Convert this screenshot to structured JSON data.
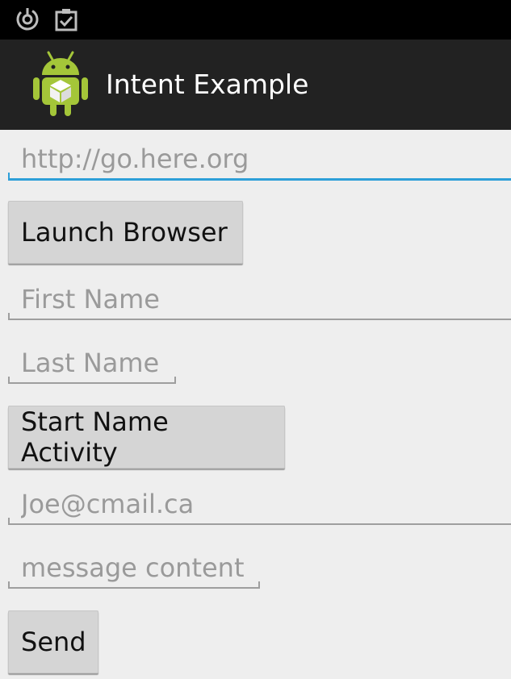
{
  "status_bar": {
    "icons": [
      "sync-icon",
      "clipboard-check-icon"
    ]
  },
  "action_bar": {
    "title": "Intent Example",
    "app_icon": "android-robot-icon"
  },
  "form": {
    "url_field": {
      "value": "",
      "placeholder": "http://go.here.org"
    },
    "launch_browser_button": "Launch Browser",
    "first_name_field": {
      "value": "",
      "placeholder": "First Name"
    },
    "last_name_field": {
      "value": "",
      "placeholder": "Last Name"
    },
    "start_name_activity_button": "Start Name Activity",
    "email_field": {
      "value": "",
      "placeholder": "Joe@cmail.ca"
    },
    "message_field": {
      "value": "",
      "placeholder": "message content"
    },
    "send_button": "Send"
  },
  "colors": {
    "status_bar": "#000000",
    "action_bar": "#222222",
    "background": "#eeeeee",
    "focus_accent": "#2d9fd8",
    "android_green": "#a4c639"
  }
}
